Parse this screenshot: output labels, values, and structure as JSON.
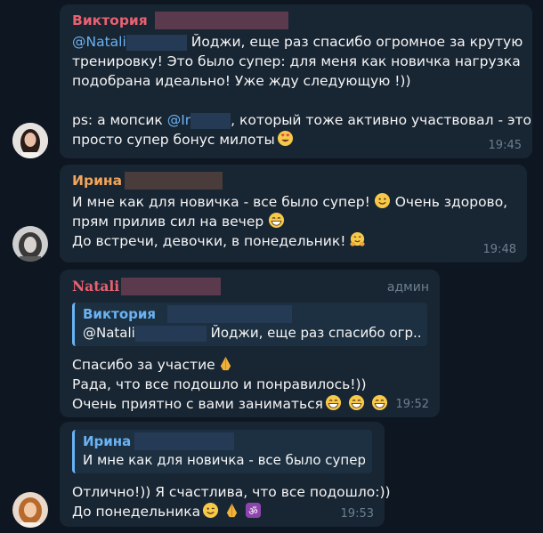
{
  "messages": [
    {
      "sender": "Виктория",
      "lines": {
        "l1_mention": "@Natali",
        "l1_text": " Йоджи, еще раз спасибо огромное за крутую",
        "l2": "тренировку! Это было супер: для меня как новичка нагрузка",
        "l3": "подобрана идеально! Уже жду следующую !))",
        "l4_pre": "ps: а мопсик ",
        "l4_mention": "@Ir",
        "l4_post": ", который тоже активно участвовал - это",
        "l5": "просто супер бонус милоты"
      },
      "time": "19:45"
    },
    {
      "sender": "Ирина",
      "lines": {
        "l1": "И мне как для новичка - все было супер!",
        "l1b": " Очень здорово,",
        "l2": "прям прилив сил на вечер",
        "l3": "До встречи, девочки, в понедельник!"
      },
      "time": "19:48"
    },
    {
      "sender": "Natali",
      "badge": "админ",
      "quote": {
        "name": "Виктория",
        "mention": "@Natali",
        "text": "Йоджи, еще раз спасибо огр..."
      },
      "lines": {
        "l1": "Спасибо за участие",
        "l2": "Рада, что все подошло и понравилось!))",
        "l3": "Очень приятно с вами заниматься"
      },
      "time": "19:52"
    },
    {
      "quote": {
        "name": "Ирина",
        "text": "И мне как для новичка - все было супер..."
      },
      "lines": {
        "l1": "Отлично!)) Я счастлива, что все подошло:))",
        "l2": "До понедельника"
      },
      "time": "19:53"
    }
  ],
  "colors": {
    "background": "#0e1621",
    "bubble": "#182533",
    "sender_red": "#e86171",
    "sender_orange": "#f1a55a",
    "link_blue": "#6ab3f3",
    "time_grey": "#6d7f8f"
  },
  "icons": [
    "heart-eyes-emoji",
    "slight-smile-emoji",
    "grin-emoji",
    "hug-emoji",
    "pray-emoji",
    "wink-emoji",
    "om-emoji"
  ]
}
